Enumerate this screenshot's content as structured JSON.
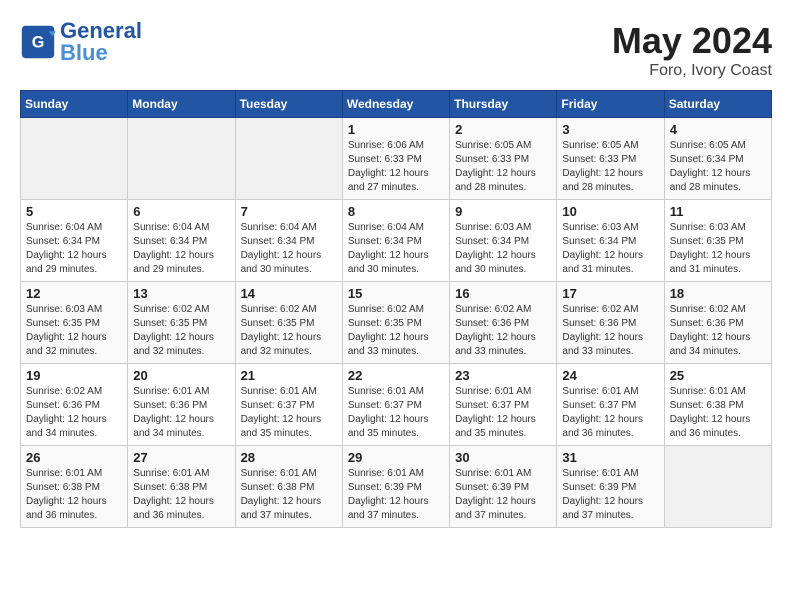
{
  "header": {
    "logo_text_general": "General",
    "logo_text_blue": "Blue",
    "month": "May 2024",
    "location": "Foro, Ivory Coast"
  },
  "weekdays": [
    "Sunday",
    "Monday",
    "Tuesday",
    "Wednesday",
    "Thursday",
    "Friday",
    "Saturday"
  ],
  "weeks": [
    [
      {
        "day": "",
        "info": ""
      },
      {
        "day": "",
        "info": ""
      },
      {
        "day": "",
        "info": ""
      },
      {
        "day": "1",
        "info": "Sunrise: 6:06 AM\nSunset: 6:33 PM\nDaylight: 12 hours and 27 minutes."
      },
      {
        "day": "2",
        "info": "Sunrise: 6:05 AM\nSunset: 6:33 PM\nDaylight: 12 hours and 28 minutes."
      },
      {
        "day": "3",
        "info": "Sunrise: 6:05 AM\nSunset: 6:33 PM\nDaylight: 12 hours and 28 minutes."
      },
      {
        "day": "4",
        "info": "Sunrise: 6:05 AM\nSunset: 6:34 PM\nDaylight: 12 hours and 28 minutes."
      }
    ],
    [
      {
        "day": "5",
        "info": "Sunrise: 6:04 AM\nSunset: 6:34 PM\nDaylight: 12 hours and 29 minutes."
      },
      {
        "day": "6",
        "info": "Sunrise: 6:04 AM\nSunset: 6:34 PM\nDaylight: 12 hours and 29 minutes."
      },
      {
        "day": "7",
        "info": "Sunrise: 6:04 AM\nSunset: 6:34 PM\nDaylight: 12 hours and 30 minutes."
      },
      {
        "day": "8",
        "info": "Sunrise: 6:04 AM\nSunset: 6:34 PM\nDaylight: 12 hours and 30 minutes."
      },
      {
        "day": "9",
        "info": "Sunrise: 6:03 AM\nSunset: 6:34 PM\nDaylight: 12 hours and 30 minutes."
      },
      {
        "day": "10",
        "info": "Sunrise: 6:03 AM\nSunset: 6:34 PM\nDaylight: 12 hours and 31 minutes."
      },
      {
        "day": "11",
        "info": "Sunrise: 6:03 AM\nSunset: 6:35 PM\nDaylight: 12 hours and 31 minutes."
      }
    ],
    [
      {
        "day": "12",
        "info": "Sunrise: 6:03 AM\nSunset: 6:35 PM\nDaylight: 12 hours and 32 minutes."
      },
      {
        "day": "13",
        "info": "Sunrise: 6:02 AM\nSunset: 6:35 PM\nDaylight: 12 hours and 32 minutes."
      },
      {
        "day": "14",
        "info": "Sunrise: 6:02 AM\nSunset: 6:35 PM\nDaylight: 12 hours and 32 minutes."
      },
      {
        "day": "15",
        "info": "Sunrise: 6:02 AM\nSunset: 6:35 PM\nDaylight: 12 hours and 33 minutes."
      },
      {
        "day": "16",
        "info": "Sunrise: 6:02 AM\nSunset: 6:36 PM\nDaylight: 12 hours and 33 minutes."
      },
      {
        "day": "17",
        "info": "Sunrise: 6:02 AM\nSunset: 6:36 PM\nDaylight: 12 hours and 33 minutes."
      },
      {
        "day": "18",
        "info": "Sunrise: 6:02 AM\nSunset: 6:36 PM\nDaylight: 12 hours and 34 minutes."
      }
    ],
    [
      {
        "day": "19",
        "info": "Sunrise: 6:02 AM\nSunset: 6:36 PM\nDaylight: 12 hours and 34 minutes."
      },
      {
        "day": "20",
        "info": "Sunrise: 6:01 AM\nSunset: 6:36 PM\nDaylight: 12 hours and 34 minutes."
      },
      {
        "day": "21",
        "info": "Sunrise: 6:01 AM\nSunset: 6:37 PM\nDaylight: 12 hours and 35 minutes."
      },
      {
        "day": "22",
        "info": "Sunrise: 6:01 AM\nSunset: 6:37 PM\nDaylight: 12 hours and 35 minutes."
      },
      {
        "day": "23",
        "info": "Sunrise: 6:01 AM\nSunset: 6:37 PM\nDaylight: 12 hours and 35 minutes."
      },
      {
        "day": "24",
        "info": "Sunrise: 6:01 AM\nSunset: 6:37 PM\nDaylight: 12 hours and 36 minutes."
      },
      {
        "day": "25",
        "info": "Sunrise: 6:01 AM\nSunset: 6:38 PM\nDaylight: 12 hours and 36 minutes."
      }
    ],
    [
      {
        "day": "26",
        "info": "Sunrise: 6:01 AM\nSunset: 6:38 PM\nDaylight: 12 hours and 36 minutes."
      },
      {
        "day": "27",
        "info": "Sunrise: 6:01 AM\nSunset: 6:38 PM\nDaylight: 12 hours and 36 minutes."
      },
      {
        "day": "28",
        "info": "Sunrise: 6:01 AM\nSunset: 6:38 PM\nDaylight: 12 hours and 37 minutes."
      },
      {
        "day": "29",
        "info": "Sunrise: 6:01 AM\nSunset: 6:39 PM\nDaylight: 12 hours and 37 minutes."
      },
      {
        "day": "30",
        "info": "Sunrise: 6:01 AM\nSunset: 6:39 PM\nDaylight: 12 hours and 37 minutes."
      },
      {
        "day": "31",
        "info": "Sunrise: 6:01 AM\nSunset: 6:39 PM\nDaylight: 12 hours and 37 minutes."
      },
      {
        "day": "",
        "info": ""
      }
    ]
  ]
}
